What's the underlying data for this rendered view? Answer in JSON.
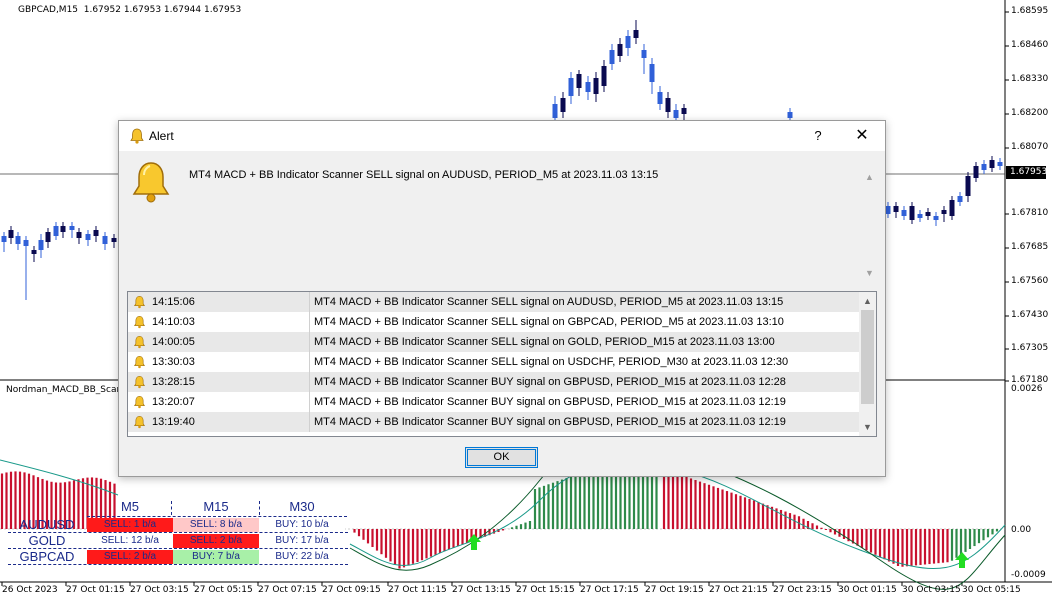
{
  "chart": {
    "symbol_line": "GBPCAD,M15  1.67952 1.67953 1.67944 1.67953",
    "indicator_label": "Nordman_MACD_BB_Scar",
    "current_price": "1.67953",
    "price_axis": [
      "1.68595",
      "1.68460",
      "1.68330",
      "1.68200",
      "1.68070",
      "1.67810",
      "1.67685",
      "1.67560",
      "1.67430",
      "1.67305",
      "1.67180"
    ],
    "indicator_axis": [
      "0.0026",
      "0.00",
      "-0.0009"
    ],
    "time_axis": [
      "26 Oct 2023",
      "27 Oct 01:15",
      "27 Oct 03:15",
      "27 Oct 05:15",
      "27 Oct 07:15",
      "27 Oct 09:15",
      "27 Oct 11:15",
      "27 Oct 13:15",
      "27 Oct 15:15",
      "27 Oct 17:15",
      "27 Oct 19:15",
      "27 Oct 21:15",
      "27 Oct 23:15",
      "30 Oct 01:15",
      "30 Oct 03:15",
      "30 Oct 05:15"
    ],
    "colors": {
      "bull": "#3060d8",
      "bear": "#0a0a50",
      "hist_up": "#2e8a4a",
      "hist_down": "#c8102e",
      "arrow": "#22dd22"
    }
  },
  "scanner": {
    "timeframes": [
      "M5",
      "M15",
      "M30"
    ],
    "rows": [
      {
        "symbol": "AUDUSD",
        "cells": [
          {
            "text": "SELL: 1 b/a",
            "bg": "#ff1a1a"
          },
          {
            "text": "SELL: 8 b/a",
            "bg": "#ffc8c8"
          },
          {
            "text": "BUY: 10 b/a",
            "bg": "#ffffff"
          }
        ]
      },
      {
        "symbol": "GOLD",
        "cells": [
          {
            "text": "SELL: 12 b/a",
            "bg": "#ffffff"
          },
          {
            "text": "SELL: 2 b/a",
            "bg": "#ff1a1a"
          },
          {
            "text": "BUY: 17 b/a",
            "bg": "#ffffff"
          }
        ]
      },
      {
        "symbol": "GBPCAD",
        "cells": [
          {
            "text": "SELL: 2 b/a",
            "bg": "#ff1a1a"
          },
          {
            "text": "BUY: 7 b/a",
            "bg": "#a8f0a8"
          },
          {
            "text": "BUY: 22 b/a",
            "bg": "#ffffff"
          }
        ]
      }
    ]
  },
  "dialog": {
    "title": "Alert",
    "help": "?",
    "close": "✕",
    "message": "MT4 MACD + BB Indicator Scanner SELL signal on AUDUSD, PERIOD_M5 at 2023.11.03 13:15",
    "ok_label": "OK",
    "alerts": [
      {
        "time": "14:15:06",
        "text": "MT4 MACD + BB Indicator Scanner SELL signal on AUDUSD, PERIOD_M5 at 2023.11.03 13:15"
      },
      {
        "time": "14:10:03",
        "text": "MT4 MACD + BB Indicator Scanner SELL signal on GBPCAD, PERIOD_M5 at 2023.11.03 13:10"
      },
      {
        "time": "14:00:05",
        "text": "MT4 MACD + BB Indicator Scanner SELL signal on GOLD, PERIOD_M15 at 2023.11.03 13:00"
      },
      {
        "time": "13:30:03",
        "text": "MT4 MACD + BB Indicator Scanner SELL signal on USDCHF, PERIOD_M30 at 2023.11.03 12:30"
      },
      {
        "time": "13:28:15",
        "text": "MT4 MACD + BB Indicator Scanner BUY signal on GBPUSD, PERIOD_M15 at 2023.11.03 12:28"
      },
      {
        "time": "13:20:07",
        "text": "MT4 MACD + BB Indicator Scanner BUY signal on GBPUSD, PERIOD_M15 at 2023.11.03 12:19"
      },
      {
        "time": "13:19:40",
        "text": "MT4 MACD + BB Indicator Scanner BUY signal on GBPUSD, PERIOD_M15 at 2023.11.03 12:19"
      }
    ]
  }
}
